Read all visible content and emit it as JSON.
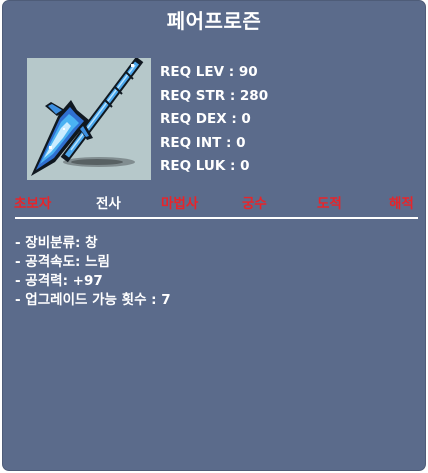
{
  "item": {
    "name": "페어프로즌",
    "icon": "frozen-spear-icon"
  },
  "requirements": [
    "REQ LEV : 90",
    "REQ STR : 280",
    "REQ DEX : 0",
    "REQ INT : 0",
    "REQ LUK : 0"
  ],
  "jobs": [
    {
      "label": "초보자",
      "color": "#e8242a"
    },
    {
      "label": "전사",
      "color": "#ffffff"
    },
    {
      "label": "마법사",
      "color": "#e8242a"
    },
    {
      "label": "궁수",
      "color": "#e8242a"
    },
    {
      "label": "도적",
      "color": "#e8242a"
    },
    {
      "label": "해적",
      "color": "#e8242a"
    }
  ],
  "stats": [
    "- 장비분류: 창",
    "- 공격속도: 느림",
    "- 공격력: +97",
    "- 업그레이드 가능 횟수 : 7"
  ],
  "colors": {
    "panel": "#5b6b8b",
    "available_job": "#ffffff",
    "unavailable_job": "#e8242a"
  }
}
